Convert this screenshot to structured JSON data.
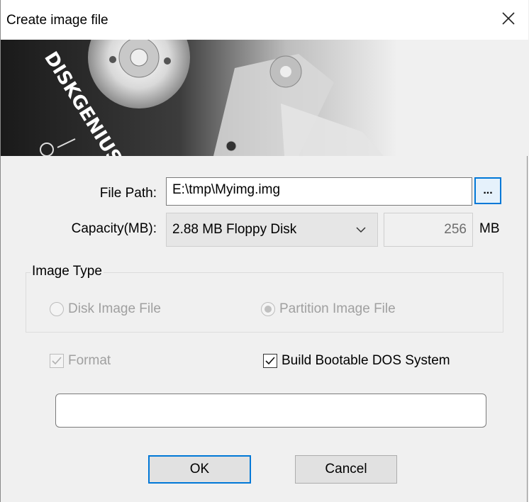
{
  "window": {
    "title": "Create image file",
    "close_icon": "close-icon"
  },
  "banner": {
    "logo_text": "DISKGENIUS"
  },
  "file_path": {
    "label": "File Path:",
    "value": "E:\\tmp\\Myimg.img",
    "browse_label": "..."
  },
  "capacity": {
    "label": "Capacity(MB):",
    "selected": "2.88 MB Floppy Disk",
    "size_value": "256",
    "unit": "MB"
  },
  "image_type": {
    "title": "Image Type",
    "options": [
      {
        "label": "Disk Image File",
        "checked": false,
        "enabled": false
      },
      {
        "label": "Partition Image File",
        "checked": true,
        "enabled": false
      }
    ]
  },
  "checkboxes": {
    "format": {
      "label": "Format",
      "checked": true,
      "enabled": false
    },
    "bootable": {
      "label": "Build Bootable DOS System",
      "checked": true,
      "enabled": true
    }
  },
  "progress_value": 0,
  "buttons": {
    "ok": "OK",
    "cancel": "Cancel"
  },
  "colors": {
    "accent": "#0078d7",
    "dialog_bg": "#f0f0f0",
    "disabled_text": "#a0a0a0"
  }
}
